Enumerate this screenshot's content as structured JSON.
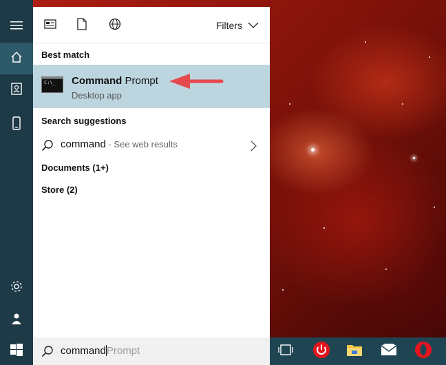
{
  "header": {
    "filters_label": "Filters"
  },
  "best_match": {
    "heading": "Best match",
    "app_name_bold": "Command",
    "app_name_rest": " Prompt",
    "app_type": "Desktop app"
  },
  "search_suggestions": {
    "heading": "Search suggestions",
    "query": "command",
    "hint": " - See web results"
  },
  "sections": {
    "documents": "Documents (1+)",
    "store": "Store (2)"
  },
  "search": {
    "typed": "command",
    "completion": "Prompt"
  },
  "colors": {
    "accent_arrow": "#e5484d",
    "selected_row": "#bcd5df",
    "rail": "#1e3a46",
    "taskbar": "#1f4553"
  },
  "icons": {
    "rail": [
      "hamburger-icon",
      "home-icon",
      "notebook-icon",
      "phone-icon",
      "settings-icon",
      "feedback-icon"
    ],
    "top": [
      "apps-filter-icon",
      "documents-filter-icon",
      "web-filter-icon"
    ],
    "taskbar": [
      "task-view-icon",
      "power-app-icon",
      "file-explorer-icon",
      "mail-icon",
      "opera-icon"
    ]
  }
}
